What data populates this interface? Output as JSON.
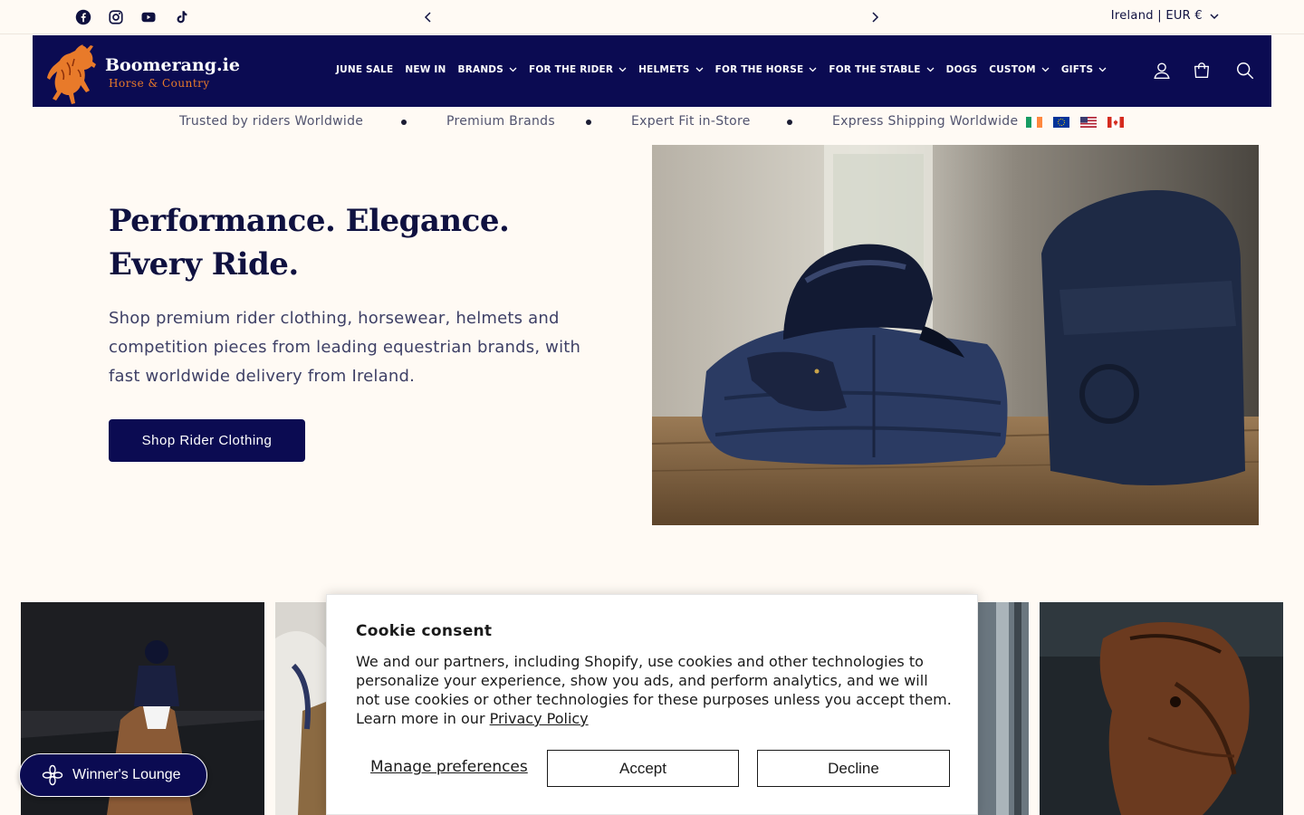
{
  "topbar": {
    "social": [
      {
        "name": "facebook-icon"
      },
      {
        "name": "instagram-icon"
      },
      {
        "name": "youtube-icon"
      },
      {
        "name": "tiktok-icon"
      }
    ],
    "locale": "Ireland | EUR €"
  },
  "header": {
    "logo_name": "Boomerang.ie",
    "logo_tagline": "Horse & Country",
    "nav": [
      {
        "label": "JUNE SALE",
        "dropdown": false
      },
      {
        "label": "NEW IN",
        "dropdown": false
      },
      {
        "label": "BRANDS",
        "dropdown": true
      },
      {
        "label": "FOR THE RIDER",
        "dropdown": true
      },
      {
        "label": "HELMETS",
        "dropdown": true
      },
      {
        "label": "FOR THE HORSE",
        "dropdown": true
      },
      {
        "label": "FOR THE STABLE",
        "dropdown": true
      },
      {
        "label": "DOGS",
        "dropdown": false
      },
      {
        "label": "CUSTOM",
        "dropdown": true
      },
      {
        "label": "GIFTS",
        "dropdown": true
      }
    ]
  },
  "trust": {
    "items": [
      "Trusted by riders Worldwide",
      "Premium Brands",
      "Expert Fit in-Store",
      "Express Shipping Worldwide"
    ],
    "flags": [
      "ireland-flag",
      "eu-flag",
      "usa-flag",
      "canada-flag"
    ]
  },
  "hero": {
    "title": "Performance. Elegance. Every Ride.",
    "subtitle": "Shop premium rider clothing, horsewear, helmets and competition pieces from leading equestrian brands, with fast worldwide delivery from Ireland.",
    "cta": "Shop Rider Clothing"
  },
  "lounge": {
    "label": "Winner's Lounge"
  },
  "cookie": {
    "title": "Cookie consent",
    "body": "We and our partners, including Shopify, use cookies and other technologies to personalize your experience, show you ads, and perform analytics, and we will not use cookies or other technologies for these purposes unless you accept them. Learn more in our ",
    "policy_link": "Privacy Policy",
    "manage": "Manage preferences",
    "accept": "Accept",
    "decline": "Decline"
  },
  "colors": {
    "navy": "#0b0b52",
    "background": "#fffaf4",
    "logo_orange": "#e87a2a"
  }
}
